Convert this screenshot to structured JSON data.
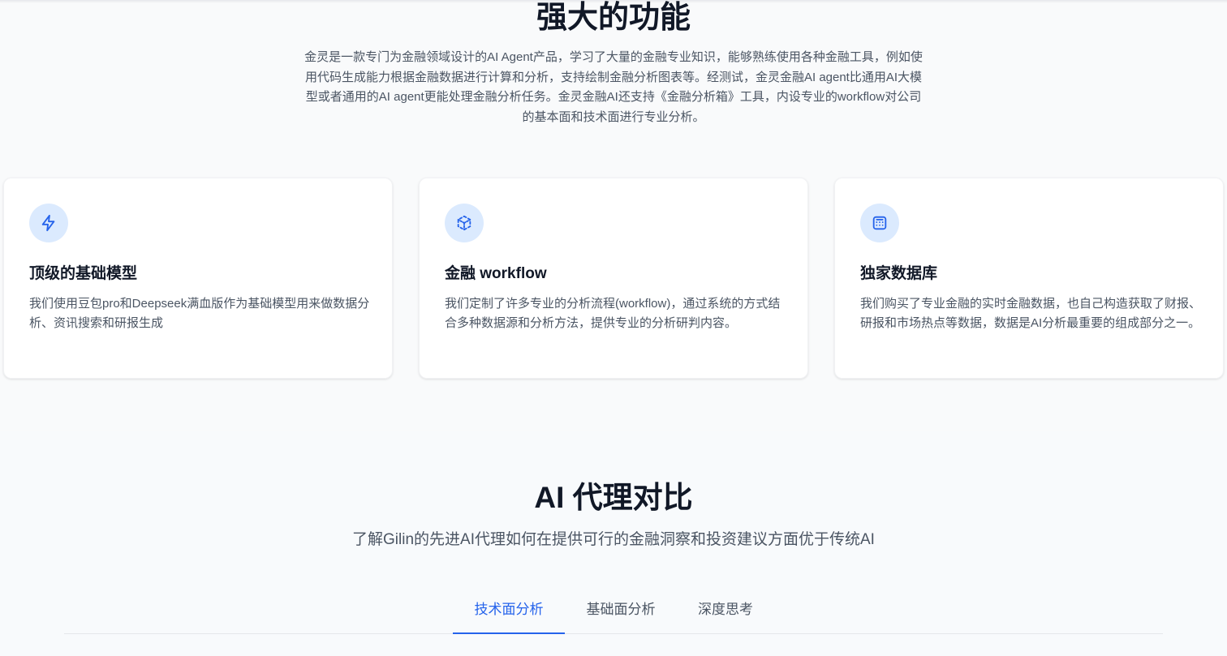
{
  "features": {
    "title": "强大的功能",
    "description": "金灵是一款专门为金融领域设计的AI Agent产品，学习了大量的金融专业知识，能够熟练使用各种金融工具，例如使用代码生成能力根据金融数据进行计算和分析，支持绘制金融分析图表等。经测试，金灵金融AI agent比通用AI大模型或者通用的AI agent更能处理金融分析任务。金灵金融AI还支持《金融分析箱》工具，内设专业的workflow对公司的基本面和技术面进行专业分析。",
    "cards": [
      {
        "icon": "lightning-icon",
        "title": "顶级的基础模型",
        "description": "我们使用豆包pro和Deepseek满血版作为基础模型用来做数据分析、资讯搜索和研报生成"
      },
      {
        "icon": "cube-icon",
        "title": "金融 workflow",
        "description": "我们定制了许多专业的分析流程(workflow)，通过系统的方式结合多种数据源和分析方法，提供专业的分析研判内容。"
      },
      {
        "icon": "calculator-icon",
        "title": "独家数据库",
        "description": "我们购买了专业金融的实时金融数据，也自己构造获取了财报、研报和市场热点等数据，数据是AI分析最重要的组成部分之一。"
      }
    ]
  },
  "comparison": {
    "title": "AI 代理对比",
    "subtitle": "了解Gilin的先进AI代理如何在提供可行的金融洞察和投资建议方面优于传统AI",
    "tabs": [
      {
        "label": "技术面分析",
        "active": true
      },
      {
        "label": "基础面分析",
        "active": false
      },
      {
        "label": "深度思考",
        "active": false
      }
    ]
  },
  "colors": {
    "accent": "#2563eb",
    "icon_bg": "#dbeafe"
  }
}
